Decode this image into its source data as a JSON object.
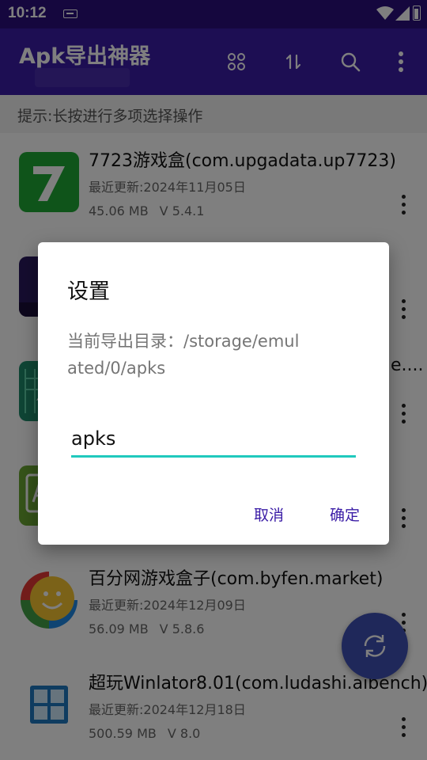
{
  "status_bar": {
    "time": "10:12"
  },
  "app_bar": {
    "title": "Apk导出神器",
    "actions": [
      "grid-view-icon",
      "sort-icon",
      "search-icon",
      "more-vert-icon"
    ]
  },
  "hint": "提示:长按进行多项选择操作",
  "apps": [
    {
      "name": "7723游戏盒(com.upgadata.up7723)",
      "date": "最近更新:2024年11月05日",
      "size": "45.06 MB",
      "version": "V 5.4.1",
      "icon_color": "#1fa834"
    },
    {
      "name": "",
      "date": "",
      "size": "",
      "version": "",
      "icon_color": "#2b1a5e"
    },
    {
      "name": "e....",
      "date": "",
      "size": "",
      "version": "",
      "icon_color": "#1e8a6a"
    },
    {
      "name": "",
      "date": "",
      "size": "",
      "version": "",
      "icon_color": "#6aa632"
    },
    {
      "name": "百分网游戏盒子(com.byfen.market)",
      "date": "最近更新:2024年12月09日",
      "size": "56.09 MB",
      "version": "V 5.8.6",
      "icon_color": "#f2b51d"
    },
    {
      "name": "超玩Winlator8.01(com.ludashi.aibench)",
      "date": "最近更新:2024年12月18日",
      "size": "500.59 MB",
      "version": "V 8.0",
      "icon_color": "#1f78c1"
    }
  ],
  "dialog": {
    "title": "设置",
    "message": "当前导出目录：/storage/emulated/0/apks",
    "input_value": "apks",
    "cancel": "取消",
    "confirm": "确定"
  },
  "colors": {
    "app_bar": "#3a1ca6",
    "status_bar": "#2a0f7d",
    "accent": "#20c9bd",
    "fab": "#3f51b5"
  }
}
